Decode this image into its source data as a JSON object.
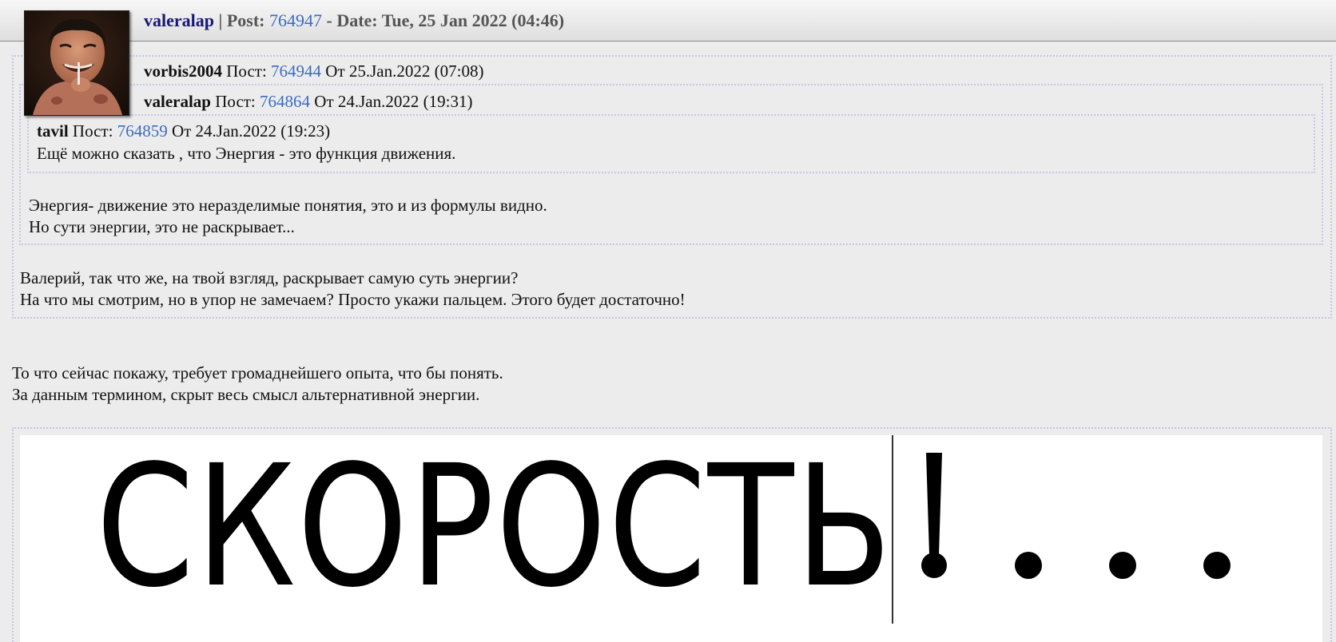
{
  "post": {
    "author": "valeralap",
    "separator": " | Post: ",
    "number": "764947",
    "date_prefix": " - Date: ",
    "date": "Tue, 25 Jan 2022 (04:46)"
  },
  "quotes": [
    {
      "author": "vorbis2004",
      "post_label": " Пост: ",
      "number": "764944",
      "date_label": " От 25.Jan.2022 (07:08)"
    },
    {
      "author": "valeralap",
      "post_label": " Пост: ",
      "number": "764864",
      "date_label": " От 24.Jan.2022 (19:31)"
    },
    {
      "author": "tavil",
      "post_label": " Пост: ",
      "number": "764859",
      "date_label": " От 24.Jan.2022 (19:23)",
      "text": "Ещё можно сказать , что Энергия - это функция движения."
    }
  ],
  "valeralap_quote_text": [
    "Энергия- движение это неразделимые понятия, это и из формулы видно.",
    "Но сути энергии, это не раскрывает..."
  ],
  "vorbis_quote_text": [
    "Валерий, так что же, на твой взгляд, раскрывает самую суть энергии?",
    "На что мы смотрим, но в упор не замечаем? Просто укажи пальцем. Этого будет достаточно!"
  ],
  "reply_text": [
    "То что сейчас покажу, требует громаднейшего опыта, что бы понять.",
    "За данным термином, скрыт весь смысл альтернативной энергии."
  ],
  "image_word": "СКОРОСТЬ",
  "colors": {
    "link": "#3b6cc0",
    "author_header": "#17177a",
    "quote_border": "#c6c6e6",
    "background": "#ececec"
  }
}
